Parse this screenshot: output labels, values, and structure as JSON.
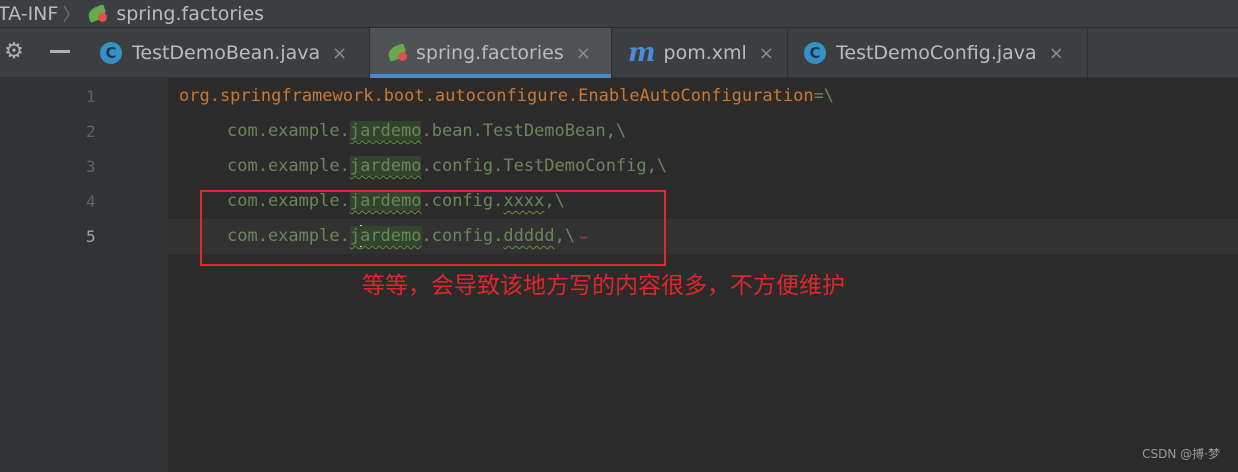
{
  "breadcrumb": {
    "parent": "TA-INF",
    "file": "spring.factories"
  },
  "tabs": [
    {
      "label": "TestDemoBean.java",
      "icon": "class-icon",
      "icon_glyph": "C",
      "active": false
    },
    {
      "label": "spring.factories",
      "icon": "spring-icon",
      "active": true
    },
    {
      "label": "pom.xml",
      "icon": "maven-icon",
      "icon_glyph": "m",
      "active": false
    },
    {
      "label": "TestDemoConfig.java",
      "icon": "class-icon",
      "icon_glyph": "C",
      "active": false
    }
  ],
  "close_glyph": "×",
  "line_numbers": [
    "1",
    "2",
    "3",
    "4",
    "5"
  ],
  "code": {
    "line1": {
      "key": "org.springframework.boot.autoconfigure.EnableAutoConfiguration",
      "eq": "=\\"
    },
    "line2": {
      "pre": "com.example.",
      "pkg": "jardemo",
      "post": ".bean.TestDemoBean,\\"
    },
    "line3": {
      "pre": "com.example.",
      "pkg": "jardemo",
      "post": ".config.TestDemoConfig,\\"
    },
    "line4": {
      "pre": "com.example.",
      "pkg": "jardemo",
      "mid": ".config.",
      "name": "xxxx",
      "post": ",\\"
    },
    "line5": {
      "pre": "com.example.",
      "pkg_a": "j",
      "pkg_b": "ardemo",
      "mid": ".config.",
      "name": "ddddd",
      "post": ",\\"
    }
  },
  "annotation": {
    "text": "等等，会导致该地方写的内容很多，不方便维护",
    "color": "#e0262b"
  },
  "watermark": "CSDN @搏·梦",
  "colors": {
    "background": "#2b2b2b",
    "gutter": "#313335",
    "tab_bar": "#3c3f41",
    "active_tab_underline": "#4a88c7",
    "key": "#cc7832",
    "value": "#6a8759"
  }
}
